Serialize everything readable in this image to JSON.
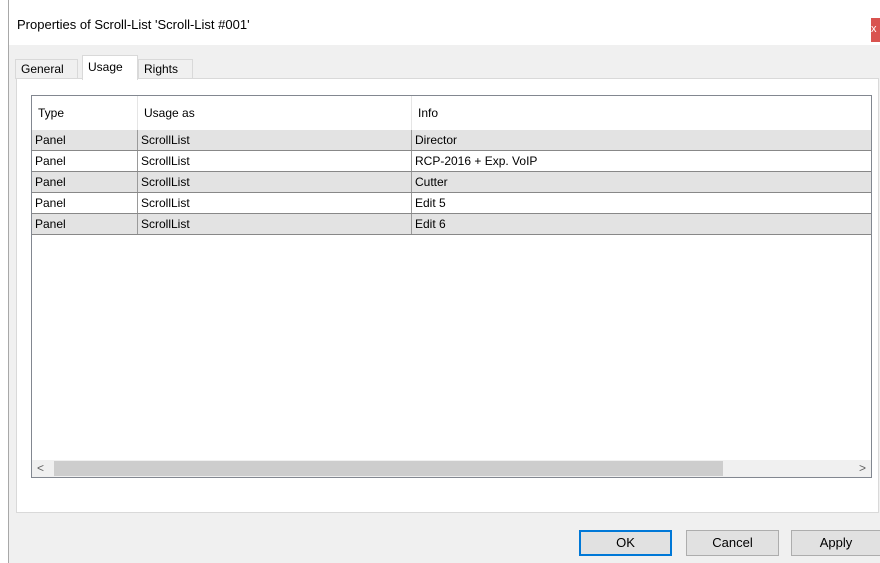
{
  "window": {
    "title": "Properties of Scroll-List 'Scroll-List #001'",
    "close_label": "x"
  },
  "tabs": [
    {
      "label": "General",
      "active": false
    },
    {
      "label": "Usage",
      "active": true
    },
    {
      "label": "Rights",
      "active": false
    }
  ],
  "table": {
    "columns": [
      "Type",
      "Usage as",
      "Info"
    ],
    "rows": [
      [
        "Panel",
        "ScrollList",
        "Director"
      ],
      [
        "Panel",
        "ScrollList",
        "RCP-2016 + Exp. VoIP"
      ],
      [
        "Panel",
        "ScrollList",
        "Cutter"
      ],
      [
        "Panel",
        "ScrollList",
        "Edit 5"
      ],
      [
        "Panel",
        "ScrollList",
        "Edit 6"
      ]
    ]
  },
  "scrollbar": {
    "left_icon": "chevron-left-icon",
    "right_icon": "chevron-right-icon",
    "left_glyph": "<",
    "right_glyph": ">"
  },
  "buttons": {
    "ok": "OK",
    "cancel": "Cancel",
    "apply": "Apply"
  }
}
